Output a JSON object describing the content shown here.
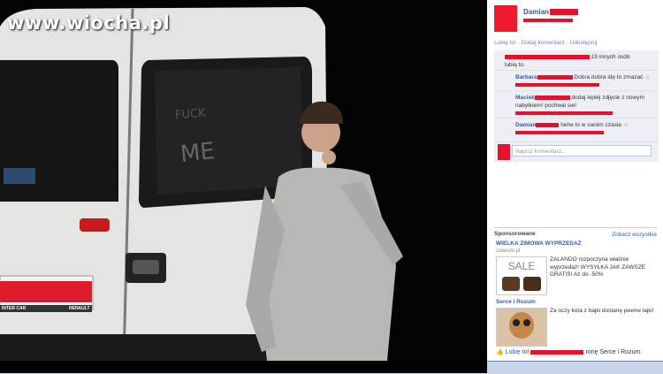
{
  "watermark": "www.wiocha.pl",
  "post": {
    "author": "Damian",
    "actions": "Lubię to! · Dodaj komentarz · Udostępnij",
    "likes_suffix": "19 innych osób",
    "likes_line2": "lubią to."
  },
  "comments": [
    {
      "name": "Barbara",
      "text": "Dobra dobra idę to zmazać"
    },
    {
      "name": "Maciek",
      "text": "dodaj lepiej zdjęcie z nowym nabytkiem! pochwal sie!"
    },
    {
      "name": "Damian",
      "text": "hehe to w swoim czasie"
    }
  ],
  "comment_placeholder": "Napisz komentarz...",
  "sponsored": {
    "title": "Sponsorowane",
    "see_all": "Zobacz wszystkie",
    "ads": [
      {
        "title": "WIELKA ZIMOWA WYPRZEDAŻ",
        "domain": "zalando.pl",
        "image_text": "SALE",
        "body": "ZALANDO rozpoczyna właśnie wyprzedaż! WYSYŁKA JAK ZAWSZE GRATIS! Aż do -50%"
      },
      {
        "title": "Serce i Rozum",
        "body": "Za oczy kota z bajki dostanę pewne lajki!",
        "like_label": "Lubię to!",
        "like_suffix": "ronę Serce i Rozum."
      }
    ]
  },
  "van_writing": {
    "line1": "FUCK",
    "line2": "ME"
  },
  "van_labels": {
    "left_plate": "INTER CAR",
    "brand": "RENAULT"
  },
  "colors": {
    "fb_blue": "#3b5998",
    "redact": "#e8102a",
    "panel_bg": "#edeff4"
  }
}
